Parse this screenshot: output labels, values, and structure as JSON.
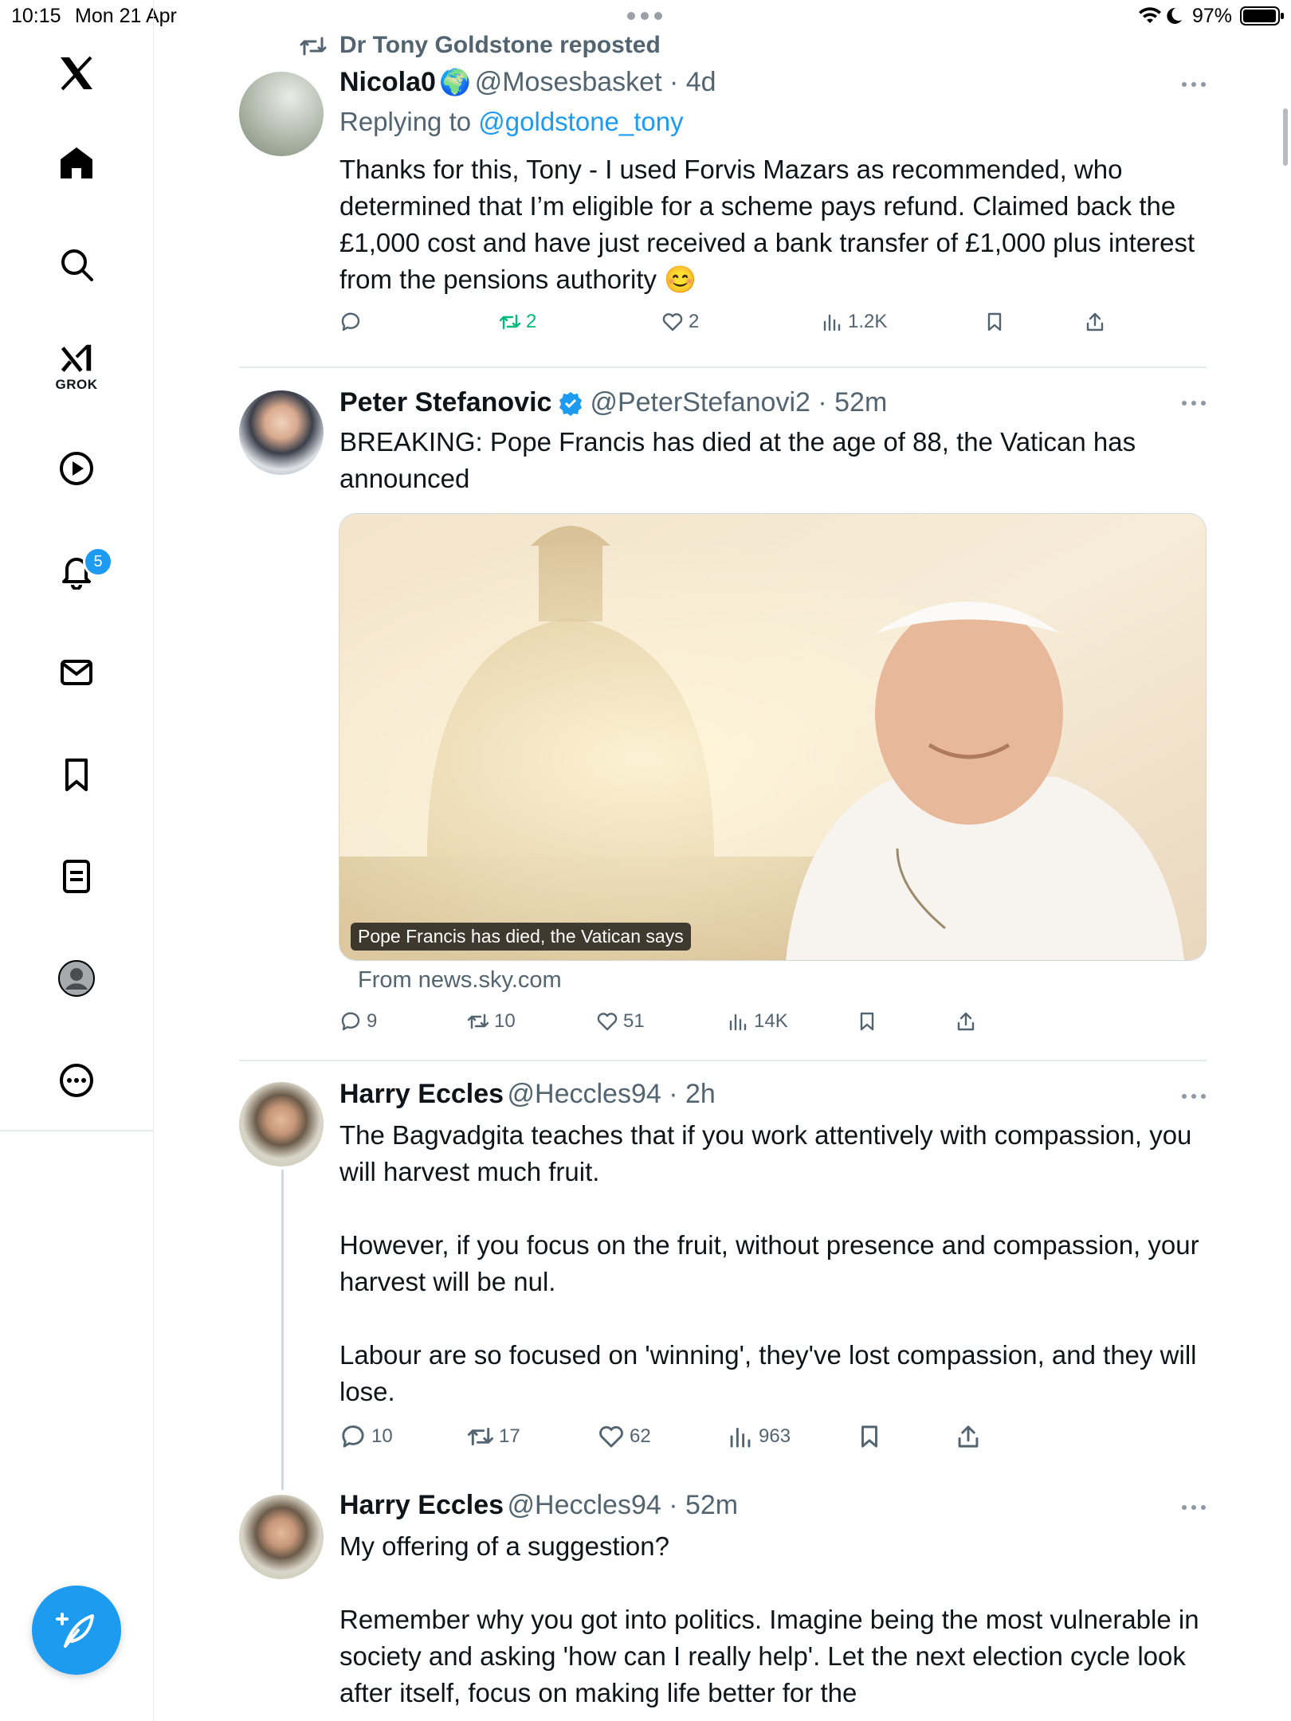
{
  "status_bar": {
    "time": "10:15",
    "date": "Mon 21 Apr",
    "battery": "97%"
  },
  "sidebar": {
    "items": [
      "X home logo",
      "Home",
      "Search",
      "Grok",
      "Videos",
      "Notifications",
      "Messages",
      "Bookmarks",
      "Lists",
      "Profile",
      "More"
    ],
    "grok_label": "GROK",
    "notification_count": "5"
  },
  "posts": [
    {
      "repost_label": "Dr Tony Goldstone reposted",
      "name": "Nicola0",
      "name_emoji": "🌍",
      "handle": "@Mosesbasket",
      "time": "4d",
      "replying_prefix": "Replying to",
      "replying_to": "@goldstone_tony",
      "text": "Thanks for this, Tony - I used Forvis Mazars as recommended, who determined that I’m eligible for a scheme pays refund. Claimed back the £1,000 cost and have just received a bank transfer of £1,000 plus interest from the pensions authority 😊",
      "replies": "",
      "reposts": "2",
      "likes": "2",
      "views": "1.2K"
    },
    {
      "name": "Peter Stefanovic",
      "handle": "@PeterStefanovi2",
      "time": "52m",
      "text": "BREAKING: Pope Francis has died at the age of 88, the Vatican has announced",
      "card_caption": "Pope Francis has died, the Vatican says",
      "card_source": "From news.sky.com",
      "replies": "9",
      "reposts": "10",
      "likes": "51",
      "views": "14K"
    },
    {
      "name": "Harry Eccles",
      "handle": "@Heccles94",
      "time": "2h",
      "text_1": "The Bagvadgita teaches that if you work attentively with compassion, you will harvest much fruit.",
      "text_2": "However, if you focus on the fruit, without presence and compassion, your harvest will be nul.",
      "text_3": "Labour are so focused on 'winning', they've lost compassion, and they will lose.",
      "replies": "10",
      "reposts": "17",
      "likes": "62",
      "views": "963"
    },
    {
      "name": "Harry Eccles",
      "handle": "@Heccles94",
      "time": "52m",
      "text_1": "My offering of a suggestion?",
      "text_2": "Remember why you got into politics. Imagine being the most vulnerable in society and asking 'how can I really help'. Let the next election cycle look after itself, focus on making life better for the"
    }
  ],
  "colors": {
    "accent": "#1d9bf0",
    "repost_green": "#00ba7c",
    "muted": "#536471",
    "divider": "#e6e9eb"
  }
}
